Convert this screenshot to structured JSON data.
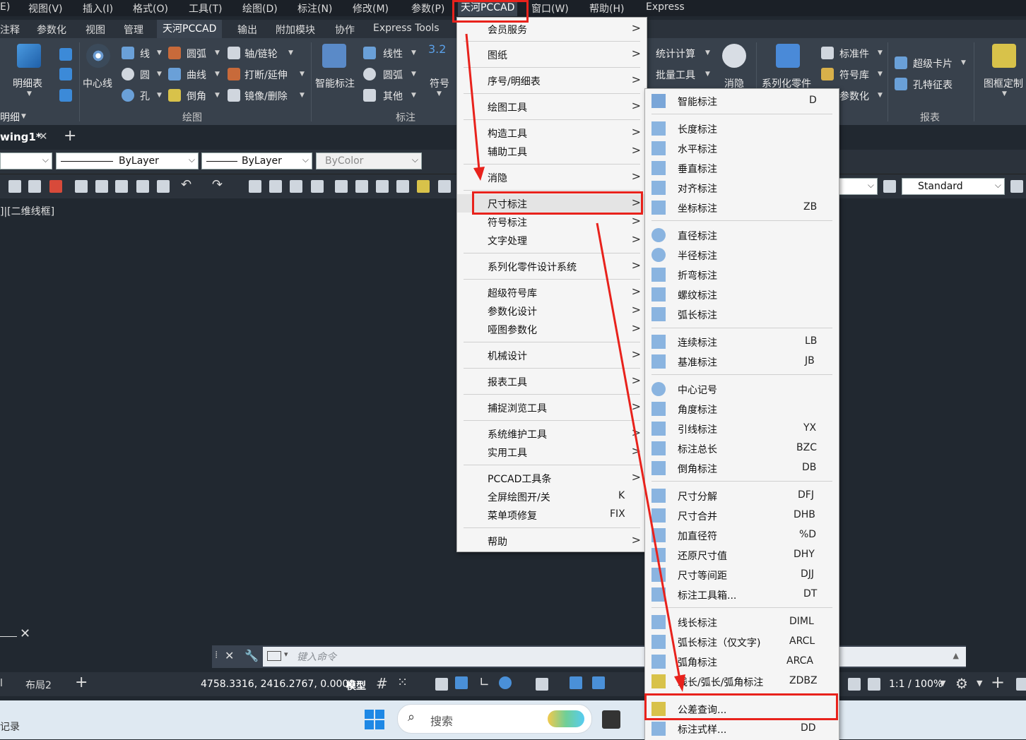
{
  "menubar": [
    "E)",
    "视图(V)",
    "插入(I)",
    "格式(O)",
    "工具(T)",
    "绘图(D)",
    "标注(N)",
    "修改(M)",
    "参数(P)",
    "天河PCCAD",
    "窗口(W)",
    "帮助(H)",
    "Express"
  ],
  "ribbon_tabs": [
    "注释",
    "参数化",
    "视图",
    "管理",
    "天河PCCAD",
    "输出",
    "附加模块",
    "协作",
    "Express Tools"
  ],
  "ribbon": {
    "mingxibiao": "明细表",
    "zhongxinxian": "中心线",
    "xian": "线",
    "yuan": "圆",
    "kong": "孔",
    "yuanhu": "圆弧",
    "quxian": "曲线",
    "daojiao": "倒角",
    "zhou": "轴/链轮",
    "daduan": "打断/延伸",
    "jingxiang": "镜像/删除",
    "zhinengbiaozhu": "智能标注",
    "xianxing": "线性",
    "yuanhu2": "圆弧",
    "qita": "其他",
    "fuhao": "符号",
    "fuhao_num": "3.2",
    "tongji": "统计计算",
    "piliang": "批量工具",
    "xiaoyin": "消隐",
    "xilie": "系列化零件",
    "biaozhunjian": "标准件",
    "fuhaoku": "符号库",
    "canshuhua": "参数化",
    "chaojikapian": "超级卡片",
    "kongtezheng": "孔特征表",
    "tukuang": "图框定制",
    "panel_huitu": "绘图",
    "panel_biaozhu": "标注",
    "panel_baobiao": "报表",
    "panel_mingxi": "明细"
  },
  "doc_tab": "wing1*",
  "props": {
    "layer": "ByLayer",
    "linetype": "ByLayer",
    "color": "ByColor",
    "style": "Standard"
  },
  "viewport_label": "]|[二维线框]",
  "command_placeholder": "键入命令",
  "status": {
    "layout1": "l",
    "layout2": "布局2",
    "coords": "4758.3316, 2416.2767, 0.0000",
    "model": "模型",
    "scale": "1:1 / 100%"
  },
  "taskbar": {
    "search": "搜索",
    "left_text": "记录"
  },
  "menu1": [
    {
      "label": "会员服务",
      "arrow": ">",
      "key": ""
    },
    {
      "label": "图纸",
      "arrow": ">",
      "key": ""
    },
    {
      "label": "序号/明细表",
      "arrow": ">",
      "key": ""
    },
    {
      "label": "绘图工具",
      "arrow": ">",
      "key": ""
    },
    {
      "label": "构造工具",
      "arrow": ">",
      "key": ""
    },
    {
      "label": "辅助工具",
      "arrow": ">",
      "key": ""
    },
    {
      "label": "消隐",
      "arrow": ">",
      "key": ""
    },
    {
      "label": "尺寸标注",
      "arrow": ">",
      "key": ""
    },
    {
      "label": "符号标注",
      "arrow": ">",
      "key": ""
    },
    {
      "label": "文字处理",
      "arrow": ">",
      "key": ""
    },
    {
      "label": "系列化零件设计系统",
      "arrow": ">",
      "key": ""
    },
    {
      "label": "超级符号库",
      "arrow": ">",
      "key": ""
    },
    {
      "label": "参数化设计",
      "arrow": ">",
      "key": ""
    },
    {
      "label": "哑图参数化",
      "arrow": ">",
      "key": ""
    },
    {
      "label": "机械设计",
      "arrow": ">",
      "key": ""
    },
    {
      "label": "报表工具",
      "arrow": ">",
      "key": ""
    },
    {
      "label": "捕捉浏览工具",
      "arrow": ">",
      "key": ""
    },
    {
      "label": "系统维护工具",
      "arrow": ">",
      "key": ""
    },
    {
      "label": "实用工具",
      "arrow": ">",
      "key": ""
    },
    {
      "label": "PCCAD工具条",
      "arrow": ">",
      "key": ""
    },
    {
      "label": "全屏绘图开/关",
      "arrow": "",
      "key": "K"
    },
    {
      "label": "菜单项修复",
      "arrow": "",
      "key": "FIX"
    },
    {
      "label": "帮助",
      "arrow": ">",
      "key": ""
    }
  ],
  "menu2": [
    {
      "label": "智能标注",
      "key": "D"
    },
    {
      "label": "长度标注",
      "key": ""
    },
    {
      "label": "水平标注",
      "key": ""
    },
    {
      "label": "垂直标注",
      "key": ""
    },
    {
      "label": "对齐标注",
      "key": ""
    },
    {
      "label": "坐标标注",
      "key": "ZB"
    },
    {
      "label": "直径标注",
      "key": ""
    },
    {
      "label": "半径标注",
      "key": ""
    },
    {
      "label": "折弯标注",
      "key": ""
    },
    {
      "label": "螺纹标注",
      "key": ""
    },
    {
      "label": "弧长标注",
      "key": ""
    },
    {
      "label": "连续标注",
      "key": "LB"
    },
    {
      "label": "基准标注",
      "key": "JB"
    },
    {
      "label": "中心记号",
      "key": ""
    },
    {
      "label": "角度标注",
      "key": ""
    },
    {
      "label": "引线标注",
      "key": "YX"
    },
    {
      "label": "标注总长",
      "key": "BZC"
    },
    {
      "label": "倒角标注",
      "key": "DB"
    },
    {
      "label": "尺寸分解",
      "key": "DFJ"
    },
    {
      "label": "尺寸合并",
      "key": "DHB"
    },
    {
      "label": "加直径符",
      "key": "%D"
    },
    {
      "label": "还原尺寸值",
      "key": "DHY"
    },
    {
      "label": "尺寸等间距",
      "key": "DJJ"
    },
    {
      "label": "标注工具箱...",
      "key": "DT"
    },
    {
      "label": "线长标注",
      "key": "DIML"
    },
    {
      "label": "弧长标注（仅文字)",
      "key": "ARCL"
    },
    {
      "label": "弧角标注",
      "key": "ARCA"
    },
    {
      "label": "线长/弧长/弧角标注",
      "key": "ZDBZ"
    },
    {
      "label": "公差查询...",
      "key": ""
    },
    {
      "label": "标注式样...",
      "key": "DD"
    }
  ],
  "colors": {
    "accent_red": "#e8221c",
    "menu_bg": "#f5f5f5",
    "app_bg": "#212830"
  }
}
